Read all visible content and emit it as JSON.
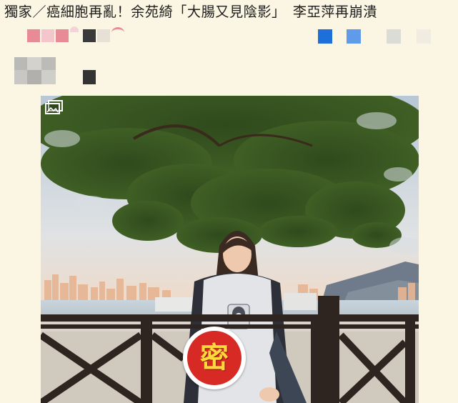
{
  "article": {
    "headline": "獨家／癌細胞再亂！余苑綺「大腸又見陰影」　李亞萍再崩潰"
  },
  "photo": {
    "gallery_icon": "gallery-icon",
    "stamp_text": "密",
    "stamp_icon": "secret-seal-icon"
  },
  "colors": {
    "page_background": "#fbf6e4",
    "stamp_red": "#d72a24",
    "stamp_text": "#ffd93b"
  }
}
